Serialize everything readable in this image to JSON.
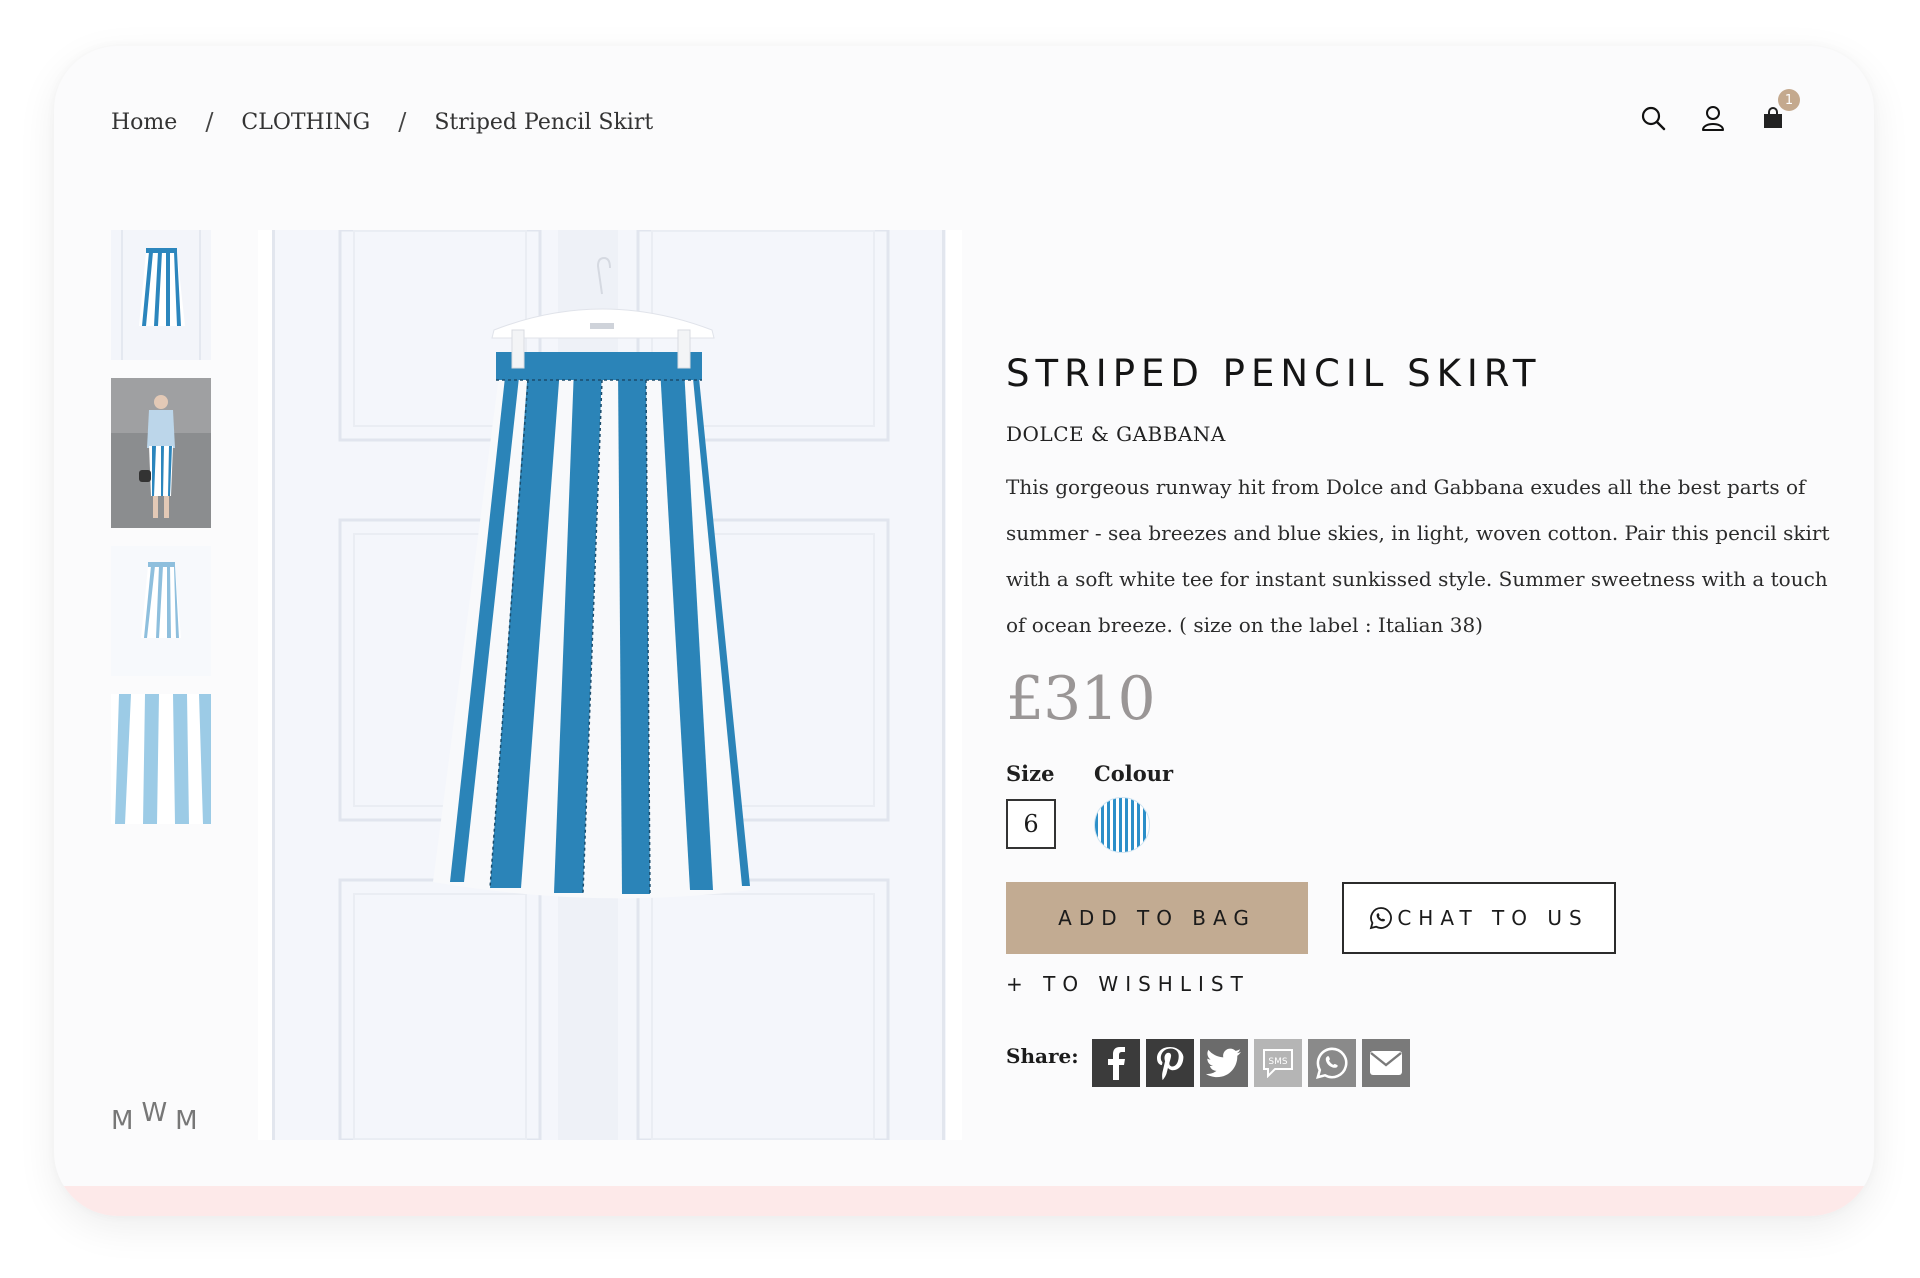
{
  "breadcrumb": {
    "home": "Home",
    "category": "CLOTHING",
    "current": "Striped Pencil Skirt",
    "separator": "/"
  },
  "header": {
    "cart_count": "1",
    "icons": [
      "search-icon",
      "user-icon",
      "shopping-bag-icon"
    ]
  },
  "product": {
    "title": "STRIPED PENCIL SKIRT",
    "brand": "DOLCE & GABBANA",
    "description": "This gorgeous runway hit from Dolce and Gabbana exudes all the best parts of summer - sea breezes and blue skies, in light, woven cotton. Pair this pencil skirt with a soft white tee for instant sunkissed style. Summer sweetness with a touch of ocean breeze. ( size on the label : Italian 38)",
    "price": "£310",
    "size_label": "Size",
    "size_value": "6",
    "colour_label": "Colour",
    "colour_swatch": "blue-white-stripes"
  },
  "actions": {
    "add_to_bag": "ADD TO BAG",
    "chat": "CHAT TO US",
    "wishlist": "+ TO WISHLIST"
  },
  "share": {
    "label": "Share:",
    "icons": [
      "facebook-icon",
      "pinterest-icon",
      "twitter-icon",
      "sms-icon",
      "whatsapp-icon",
      "email-icon"
    ]
  },
  "logo": {
    "letters": [
      "M",
      "W",
      "M"
    ]
  },
  "colors": {
    "accent": "#c2ab92",
    "stripe_blue": "#2c8fc9",
    "cart_badge": "#c4a98e"
  }
}
